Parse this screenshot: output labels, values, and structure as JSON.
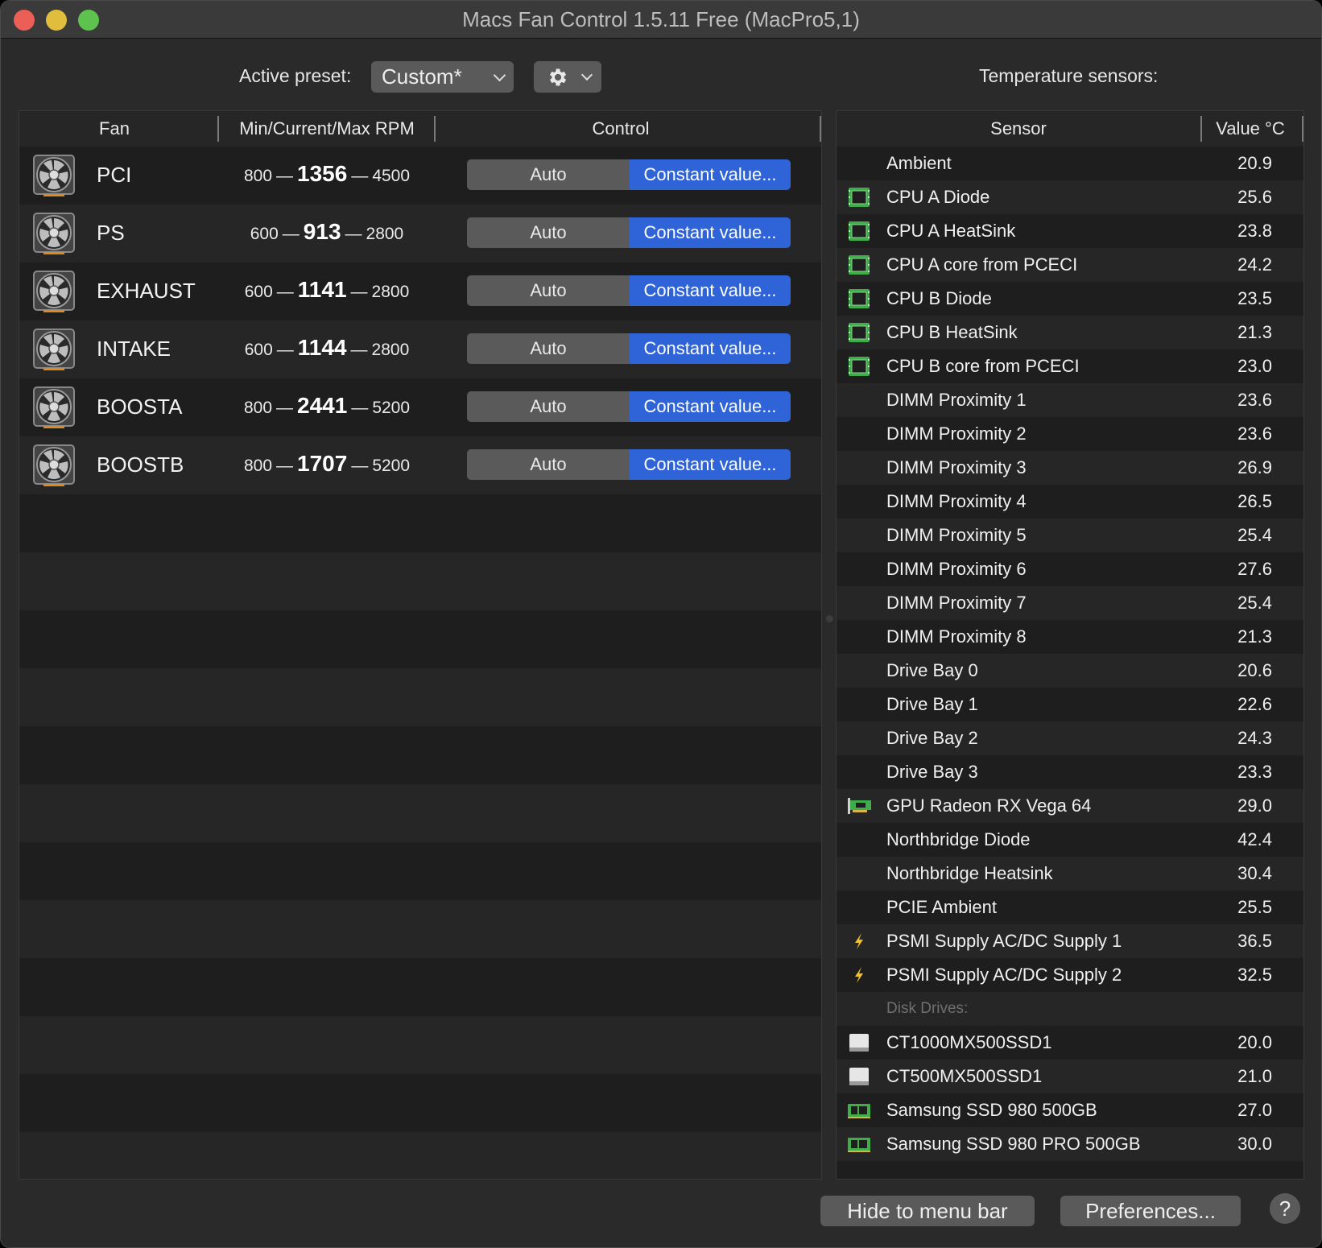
{
  "window": {
    "title": "Macs Fan Control 1.5.11 Free (MacPro5,1)"
  },
  "toolbar": {
    "preset_label": "Active preset:",
    "preset_value": "Custom*",
    "sensors_title": "Temperature sensors:"
  },
  "fan_table": {
    "headers": [
      "Fan",
      "Min/Current/Max RPM",
      "Control"
    ],
    "rows": [
      {
        "name": "PCI",
        "min": "800",
        "current": "1356",
        "max": "4500",
        "auto": "Auto",
        "const": "Constant value..."
      },
      {
        "name": "PS",
        "min": "600",
        "current": "913",
        "max": "2800",
        "auto": "Auto",
        "const": "Constant value..."
      },
      {
        "name": "EXHAUST",
        "min": "600",
        "current": "1141",
        "max": "2800",
        "auto": "Auto",
        "const": "Constant value..."
      },
      {
        "name": "INTAKE",
        "min": "600",
        "current": "1144",
        "max": "2800",
        "auto": "Auto",
        "const": "Constant value..."
      },
      {
        "name": "BOOSTA",
        "min": "800",
        "current": "2441",
        "max": "5200",
        "auto": "Auto",
        "const": "Constant value..."
      },
      {
        "name": "BOOSTB",
        "min": "800",
        "current": "1707",
        "max": "5200",
        "auto": "Auto",
        "const": "Constant value..."
      }
    ],
    "dash": "—"
  },
  "sensor_table": {
    "headers": [
      "Sensor",
      "Value °C"
    ],
    "rows": [
      {
        "name": "Ambient",
        "value": "20.9",
        "icon": "none"
      },
      {
        "name": "CPU A Diode",
        "value": "25.6",
        "icon": "cpu-chip-icon"
      },
      {
        "name": "CPU A HeatSink",
        "value": "23.8",
        "icon": "cpu-chip-icon"
      },
      {
        "name": "CPU A core from PCECI",
        "value": "24.2",
        "icon": "cpu-chip-icon"
      },
      {
        "name": "CPU B Diode",
        "value": "23.5",
        "icon": "cpu-chip-icon"
      },
      {
        "name": "CPU B HeatSink",
        "value": "21.3",
        "icon": "cpu-chip-icon"
      },
      {
        "name": "CPU B core from PCECI",
        "value": "23.0",
        "icon": "cpu-chip-icon"
      },
      {
        "name": "DIMM Proximity 1",
        "value": "23.6",
        "icon": "none"
      },
      {
        "name": "DIMM Proximity 2",
        "value": "23.6",
        "icon": "none"
      },
      {
        "name": "DIMM Proximity 3",
        "value": "26.9",
        "icon": "none"
      },
      {
        "name": "DIMM Proximity 4",
        "value": "26.5",
        "icon": "none"
      },
      {
        "name": "DIMM Proximity 5",
        "value": "25.4",
        "icon": "none"
      },
      {
        "name": "DIMM Proximity 6",
        "value": "27.6",
        "icon": "none"
      },
      {
        "name": "DIMM Proximity 7",
        "value": "25.4",
        "icon": "none"
      },
      {
        "name": "DIMM Proximity 8",
        "value": "21.3",
        "icon": "none"
      },
      {
        "name": "Drive Bay 0",
        "value": "20.6",
        "icon": "none"
      },
      {
        "name": "Drive Bay 1",
        "value": "22.6",
        "icon": "none"
      },
      {
        "name": "Drive Bay 2",
        "value": "24.3",
        "icon": "none"
      },
      {
        "name": "Drive Bay 3",
        "value": "23.3",
        "icon": "none"
      },
      {
        "name": "GPU Radeon RX Vega 64",
        "value": "29.0",
        "icon": "gpu-card-icon"
      },
      {
        "name": "Northbridge Diode",
        "value": "42.4",
        "icon": "none"
      },
      {
        "name": "Northbridge Heatsink",
        "value": "30.4",
        "icon": "none"
      },
      {
        "name": "PCIE Ambient",
        "value": "25.5",
        "icon": "none"
      },
      {
        "name": "PSMI Supply AC/DC Supply 1",
        "value": "36.5",
        "icon": "lightning-icon"
      },
      {
        "name": "PSMI Supply AC/DC Supply 2",
        "value": "32.5",
        "icon": "lightning-icon"
      },
      {
        "name": "Disk Drives:",
        "value": "",
        "icon": "none",
        "section": true
      },
      {
        "name": "CT1000MX500SSD1",
        "value": "20.0",
        "icon": "disk-drive-icon"
      },
      {
        "name": "CT500MX500SSD1",
        "value": "21.0",
        "icon": "disk-drive-icon"
      },
      {
        "name": "Samsung SSD 980 500GB",
        "value": "27.0",
        "icon": "nvme-ssd-icon"
      },
      {
        "name": "Samsung SSD 980 PRO 500GB",
        "value": "30.0",
        "icon": "nvme-ssd-icon"
      }
    ]
  },
  "footer": {
    "hide_label": "Hide to menu bar",
    "prefs_label": "Preferences...",
    "help_label": "?"
  },
  "colors": {
    "accent": "#2f64d8",
    "window_bg": "#2a2a2a",
    "row_a": "#1e1e1e",
    "row_b": "#262626",
    "chip_green": "#3fae4a"
  }
}
